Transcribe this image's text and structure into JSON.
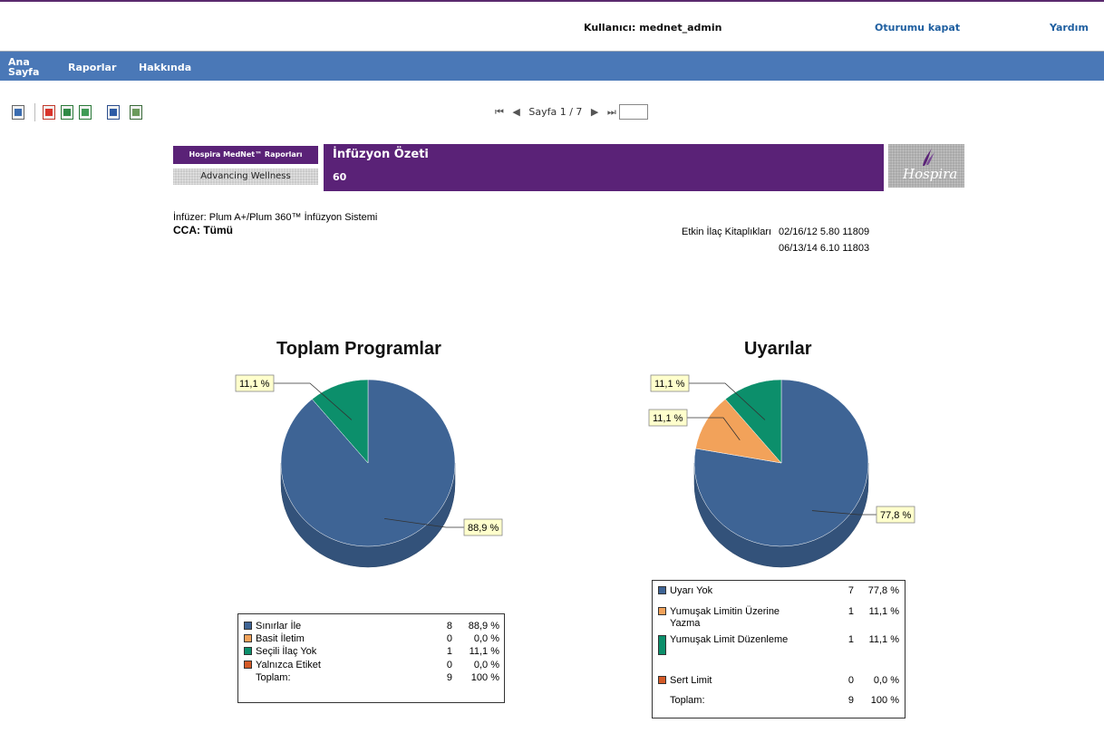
{
  "header": {
    "user_label": "Kullanıcı: mednet_admin",
    "logout": "Oturumu kapat",
    "help": "Yardım"
  },
  "nav": {
    "items": [
      "Ana Sayfa",
      "Raporlar",
      "Hakkında"
    ]
  },
  "toolbar": {
    "icons": [
      "export-icon",
      "pdf-icon",
      "excel-icon",
      "excel-data-icon",
      "word-icon",
      "rtf-icon"
    ]
  },
  "pager": {
    "first": "⏮",
    "prev": "◀",
    "label": "Sayfa 1 / 7",
    "next": "▶",
    "last": "⏭",
    "goto_value": ""
  },
  "banner": {
    "brand_label": "Hospira MedNet™ Raporları",
    "tagline": "Advancing Wellness",
    "title": "İnfüzyon Özeti",
    "subtitle": "60",
    "logo_text": "Hospira"
  },
  "info": {
    "infuser": "İnfüzer: Plum A+/Plum 360™ İnfüzyon Sistemi",
    "cca": "CCA: Tümü",
    "libraries_label": "Etkin İlaç Kitaplıkları",
    "libraries": [
      "02/16/12 5.80 11809",
      "06/13/14 6.10 11803"
    ]
  },
  "colors": {
    "blue": "#3e6495",
    "orange": "#f2a25a",
    "green": "#0c8f6b",
    "red": "#d45a27",
    "purple": "#5a2277",
    "nav": "#4a78b7"
  },
  "chart_data": [
    {
      "type": "pie",
      "title": "Toplam Programlar",
      "categories": [
        "Sınırlar İle",
        "Basit İletim",
        "Seçili İlaç Yok",
        "Yalnızca Etiket"
      ],
      "values": [
        8,
        0,
        1,
        0
      ],
      "percent_labels": [
        "88,9 %",
        "0,0 %",
        "11,1 %",
        "0,0 %"
      ],
      "data_labels": [
        "88,9 %",
        "11,1 %"
      ],
      "total_label": "Toplam:",
      "total": 9,
      "total_percent": "100 %",
      "colors": [
        "#3e6495",
        "#f2a25a",
        "#0c8f6b",
        "#d45a27"
      ]
    },
    {
      "type": "pie",
      "title": "Uyarılar",
      "categories": [
        "Uyarı Yok",
        "Yumuşak Limitin Üzerine Yazma",
        "Yumuşak Limit Düzenleme",
        "Sert Limit"
      ],
      "values": [
        7,
        1,
        1,
        0
      ],
      "percent_labels": [
        "77,8 %",
        "11,1 %",
        "11,1 %",
        "0,0 %"
      ],
      "data_labels": [
        "77,8 %",
        "11,1 %",
        "11,1 %"
      ],
      "total_label": "Toplam:",
      "total": 9,
      "total_percent": "100 %",
      "colors": [
        "#3e6495",
        "#f2a25a",
        "#0c8f6b",
        "#d45a27"
      ]
    }
  ]
}
